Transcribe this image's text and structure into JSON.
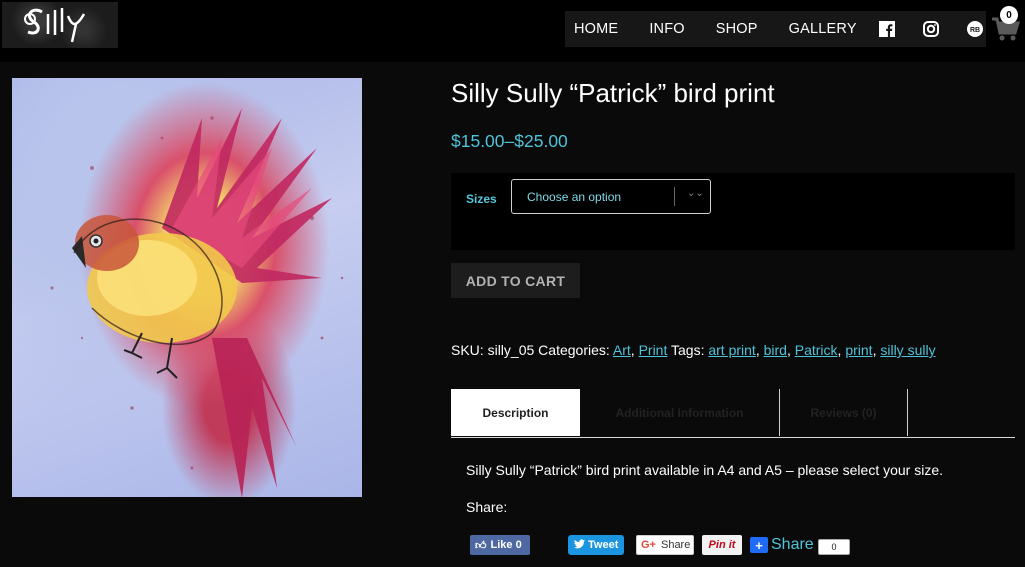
{
  "header": {
    "logo_alt": "Silly",
    "nav": [
      "HOME",
      "INFO",
      "SHOP",
      "GALLERY"
    ],
    "social_icons": [
      "facebook-icon",
      "instagram-icon",
      "redbubble-icon"
    ],
    "cart_count": "0"
  },
  "product": {
    "title": "Silly Sully “Patrick” bird print",
    "price": "$15.00–$25.00",
    "sizes_label": "Sizes",
    "select_placeholder": "Choose an option",
    "add_to_cart": "ADD TO CART",
    "meta": {
      "sku_label": "SKU:",
      "sku": "silly_05",
      "categories_label": "Categories:",
      "categories": [
        "Art",
        "Print"
      ],
      "tags_label": "Tags:",
      "tags": [
        "art print",
        "bird",
        "Patrick",
        "print",
        "silly sully"
      ]
    }
  },
  "tabs": {
    "items": [
      "Description",
      "Additional Information",
      "Reviews (0)"
    ],
    "active": "Description",
    "description": "Silly Sully “Patrick” bird print available in A4 and A5 – please select your size.",
    "share_label": "Share:"
  },
  "share_buttons": {
    "like": "Like 0",
    "tweet": "Tweet",
    "gplus": "Share",
    "pinit": "Pin it",
    "share": "Share",
    "share_count": "0"
  },
  "colors": {
    "accent": "#4fc3da",
    "background": "#0a0a0a",
    "header_bg": "#000000"
  }
}
